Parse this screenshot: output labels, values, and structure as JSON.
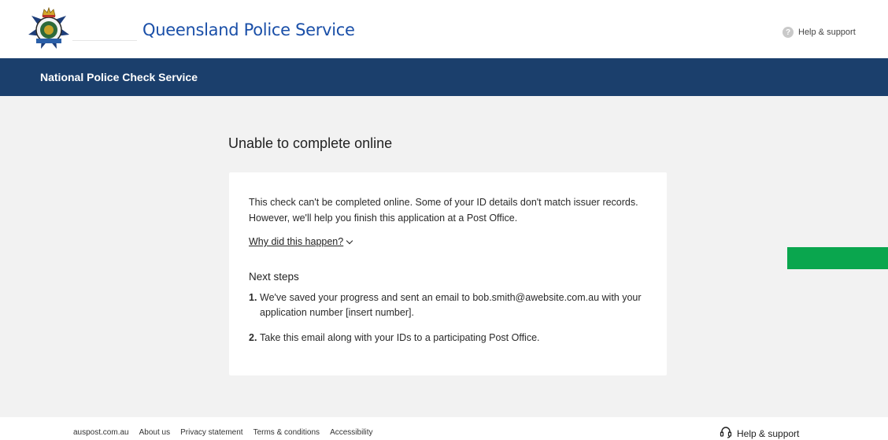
{
  "header": {
    "brand_name": "Queensland Police Service",
    "help_label": "Help & support",
    "help_icon": "question-circle-icon"
  },
  "navbar": {
    "title": "National Police Check Service"
  },
  "main": {
    "page_title": "Unable to complete online",
    "message": "This check can't be completed online. Some of your ID details don't match issuer records. However, we'll help you finish this application at a Post Office.",
    "why_link": "Why did this happen?",
    "next_steps_heading": "Next steps",
    "steps": [
      {
        "number": "1.",
        "text": "We've saved your progress and sent an email to bob.smith@awebsite.com.au with your application number [insert number]."
      },
      {
        "number": "2.",
        "text": "Take this email along with your IDs to a participating Post Office."
      }
    ]
  },
  "footer": {
    "links": [
      "auspost.com.au",
      "About us",
      "Privacy statement",
      "Terms & conditions",
      "Accessibility"
    ],
    "help_label": "Help & support",
    "help_icon": "headset-icon"
  },
  "colors": {
    "navbar": "#1b3f6c",
    "brand_text": "#1a4fa8",
    "green_tab": "#0aa64e",
    "background": "#f2f2f2"
  }
}
